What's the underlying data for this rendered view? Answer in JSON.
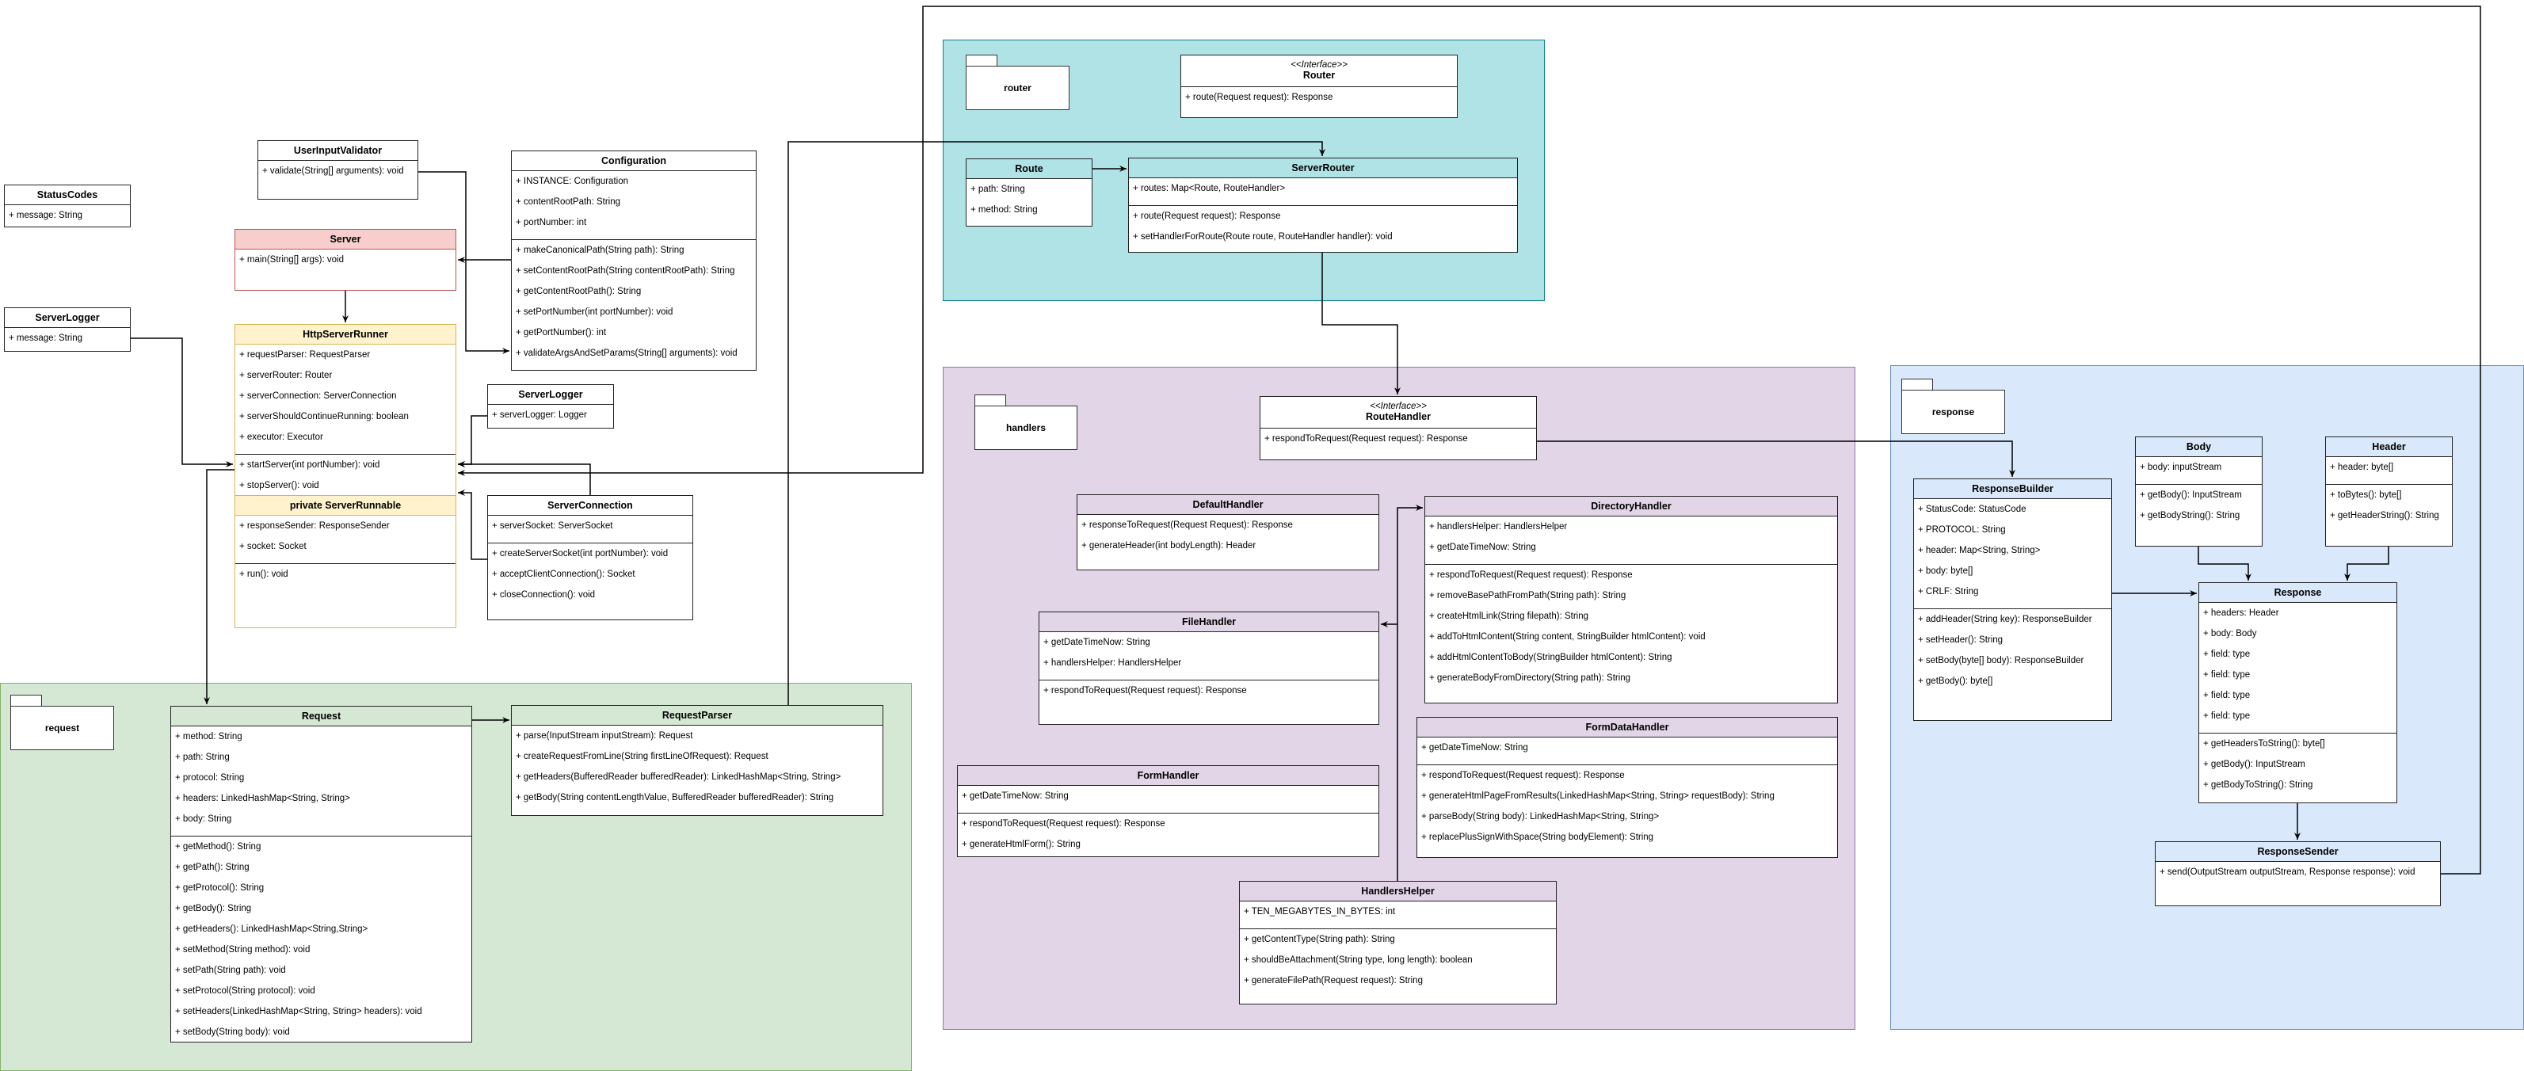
{
  "packages": {
    "router": {
      "label": "router",
      "color": "#b0e3e6"
    },
    "handlers": {
      "label": "handlers",
      "color": "#e1d5e7"
    },
    "response": {
      "label": "response",
      "color": "#dae8fc"
    },
    "request": {
      "label": "request",
      "color": "#d5e8d4"
    }
  },
  "classes": {
    "statusCodes": {
      "name": "StatusCodes",
      "fields": [
        "+ message: String"
      ],
      "methods": []
    },
    "serverLoggerLeft": {
      "name": "ServerLogger",
      "fields": [
        "+ message: String"
      ],
      "methods": []
    },
    "userInputValidator": {
      "name": "UserInputValidator",
      "fields": [
        "+ validate(String[] arguments): void"
      ],
      "methods": []
    },
    "server": {
      "name": "Server",
      "fields": [
        "+ main(String[] args): void"
      ],
      "methods": []
    },
    "configuration": {
      "name": "Configuration",
      "fields": [
        "+ INSTANCE: Configuration",
        "+ contentRootPath: String",
        "+ portNumber: int"
      ],
      "methods": [
        "+ makeCanonicalPath(String path): String",
        "+ setContentRootPath(String contentRootPath): String",
        "+ getContentRootPath(): String",
        "+ setPortNumber(int portNumber): void",
        "+ getPortNumber(): int",
        "+ validateArgsAndSetParams(String[] arguments): void"
      ]
    },
    "httpServerRunner": {
      "name": "HttpServerRunner",
      "fields": [
        "+ requestParser: RequestParser",
        "+ serverRouter: Router",
        "+ serverConnection: ServerConnection",
        "+ serverShouldContinueRunning: boolean",
        "+ executor: Executor"
      ],
      "methods": [
        "+ startServer(int portNumber): void",
        "+ stopServer(): void"
      ]
    },
    "serverRunnable": {
      "name": "private ServerRunnable",
      "fields": [
        "+ responseSender: ResponseSender",
        "+ socket: Socket"
      ],
      "methods": [
        "+ run(): void"
      ]
    },
    "serverLoggerMid": {
      "name": "ServerLogger",
      "fields": [
        "+ serverLogger: Logger"
      ],
      "methods": []
    },
    "serverConnection": {
      "name": "ServerConnection",
      "fields": [
        "+ serverSocket: ServerSocket"
      ],
      "methods": [
        "+ createServerSocket(int portNumber): void",
        "+ acceptClientConnection(): Socket",
        "+ closeConnection(): void"
      ]
    },
    "request": {
      "name": "Request",
      "fields": [
        "+ method: String",
        "+ path: String",
        "+ protocol: String",
        "+ headers: LinkedHashMap<String, String>",
        "+ body: String"
      ],
      "methods": [
        "+ getMethod(): String",
        "+ getPath(): String",
        "+ getProtocol(): String",
        "+ getBody(): String",
        "+ getHeaders(): LinkedHashMap<String,String>",
        "+ setMethod(String method): void",
        "+ setPath(String path): void",
        "+ setProtocol(String protocol): void",
        "+ setHeaders(LinkedHashMap<String, String> headers): void",
        "+ setBody(String body): void"
      ]
    },
    "requestParser": {
      "name": "RequestParser",
      "fields": [
        "+ parse(InputStream inputStream): Request",
        "+ createRequestFromLine(String firstLineOfRequest): Request",
        "+ getHeaders(BufferedReader bufferedReader): LinkedHashMap<String, String>",
        "+ getBody(String contentLengthValue, BufferedReader bufferedReader): String"
      ],
      "methods": []
    },
    "router": {
      "stereotype": "<<Interface>>",
      "name": "Router",
      "fields": [
        "+ route(Request request): Response"
      ],
      "methods": []
    },
    "route": {
      "name": "Route",
      "fields": [
        "+ path: String",
        "+ method: String"
      ],
      "methods": []
    },
    "serverRouter": {
      "name": "ServerRouter",
      "fields": [
        "+ routes: Map<Route, RouteHandler>"
      ],
      "methods": [
        "+ route(Request request): Response",
        "+ setHandlerForRoute(Route route, RouteHandler handler): void"
      ]
    },
    "routeHandler": {
      "stereotype": "<<Interface>>",
      "name": "RouteHandler",
      "fields": [
        "+ respondToRequest(Request request): Response"
      ],
      "methods": []
    },
    "defaultHandler": {
      "name": "DefaultHandler",
      "fields": [
        "+ responseToRequest(Request Request): Response",
        "+ generateHeader(int bodyLength): Header"
      ],
      "methods": []
    },
    "fileHandler": {
      "name": "FileHandler",
      "fields": [
        "+ getDateTimeNow: String",
        "+ handlersHelper: HandlersHelper"
      ],
      "methods": [
        "+ respondToRequest(Request request): Response"
      ]
    },
    "directoryHandler": {
      "name": "DirectoryHandler",
      "fields": [
        "+ handlersHelper: HandlersHelper",
        "+ getDateTimeNow: String"
      ],
      "methods": [
        "+ respondToRequest(Request request): Response",
        "+ removeBasePathFromPath(String path): String",
        "+ createHtmlLink(String filepath): String",
        "+ addToHtmlContent(String content, StringBuilder htmlContent): void",
        "+ addHtmlContentToBody(StringBuilder htmlContent): String",
        "+ generateBodyFromDirectory(String path): String"
      ]
    },
    "formHandler": {
      "name": "FormHandler",
      "fields": [
        "+ getDateTimeNow: String"
      ],
      "methods": [
        "+ respondToRequest(Request request): Response",
        "+ generateHtmlForm(): String"
      ]
    },
    "formDataHandler": {
      "name": "FormDataHandler",
      "fields": [
        "+ getDateTimeNow: String"
      ],
      "methods": [
        "+ respondToRequest(Request request): Response",
        "+ generateHtmlPageFromResults(LinkedHashMap<String, String> requestBody): String",
        "+ parseBody(String body): LinkedHashMap<String, String>",
        "+ replacePlusSignWithSpace(String bodyElement): String"
      ]
    },
    "handlersHelper": {
      "name": "HandlersHelper",
      "fields": [
        "+ TEN_MEGABYTES_IN_BYTES: int"
      ],
      "methods": [
        "+ getContentType(String path): String",
        "+ shouldBeAttachment(String type, long length): boolean",
        "+ generateFilePath(Request request): String"
      ]
    },
    "responseBuilder": {
      "name": "ResponseBuilder",
      "fields": [
        "+ StatusCode: StatusCode",
        "+ PROTOCOL: String",
        "+ header: Map<String, String>",
        "+ body: byte[]",
        "+ CRLF: String"
      ],
      "methods": [
        "+ addHeader(String key): ResponseBuilder",
        "+ setHeader(): String",
        "+ setBody(byte[] body): ResponseBuilder",
        "+ getBody(): byte[]"
      ]
    },
    "body": {
      "name": "Body",
      "fields": [
        "+ body: inputStream"
      ],
      "methods": [
        "+ getBody(): InputStream",
        "+ getBodyString(): String"
      ]
    },
    "header": {
      "name": "Header",
      "fields": [
        "+ header: byte[]"
      ],
      "methods": [
        "+ toBytes(): byte[]",
        "+ getHeaderString(): String"
      ]
    },
    "response": {
      "name": "Response",
      "fields": [
        "+ headers: Header",
        "+ body: Body",
        "+ field: type",
        "+ field: type",
        "+ field: type",
        "+ field: type"
      ],
      "methods": [
        "+ getHeadersToString(): byte[]",
        "+ getBody(): InputStream",
        "+ getBodyToString(): String"
      ]
    },
    "responseSender": {
      "name": "ResponseSender",
      "fields": [
        "+ send(OutputStream outputStream, Response response): void"
      ],
      "methods": []
    }
  }
}
